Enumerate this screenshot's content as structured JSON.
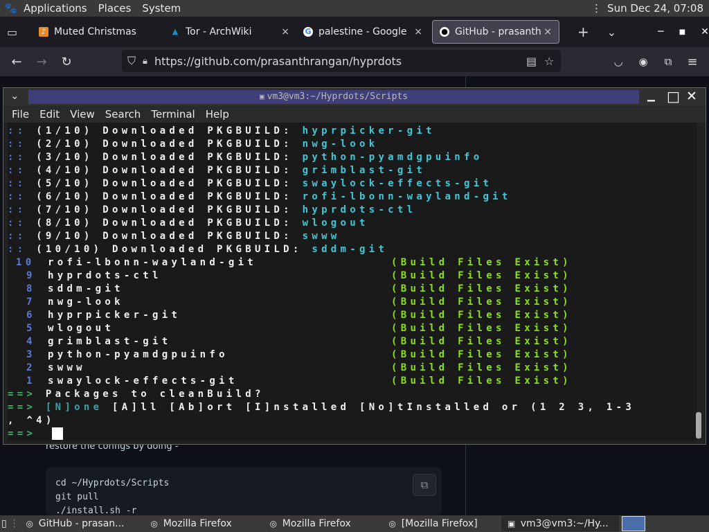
{
  "top_panel": {
    "menus": [
      "Applications",
      "Places",
      "System"
    ],
    "clock": "Sun Dec 24, 07:08"
  },
  "firefox": {
    "tabs": [
      {
        "title": "Muted Christmas",
        "close": "×"
      },
      {
        "title": "Tor - ArchWiki",
        "close": "×"
      },
      {
        "title": "palestine - Google",
        "close": "×"
      },
      {
        "title": "GitHub - prasanth",
        "close": "×"
      }
    ],
    "new_tab": "+",
    "tab_list": "⌄",
    "url": "https://github.com/prasanthrangan/hyprdots",
    "page": {
      "restore_text": "restore the configs by doing -",
      "code": "cd ~/Hyprdots/Scripts\ngit pull\n./install.sh -r"
    }
  },
  "terminal": {
    "title": "vm3@vm3:~/Hyprdots/Scripts",
    "menu": [
      "File",
      "Edit",
      "View",
      "Search",
      "Terminal",
      "Help"
    ],
    "downloads": [
      {
        "prefix": ":: ",
        "count": "(1/10)",
        "text": "Downloaded PKGBUILD:",
        "pkg": "hyprpicker-git"
      },
      {
        "prefix": ":: ",
        "count": "(2/10)",
        "text": "Downloaded PKGBUILD:",
        "pkg": "nwg-look"
      },
      {
        "prefix": ":: ",
        "count": "(3/10)",
        "text": "Downloaded PKGBUILD:",
        "pkg": "python-pyamdgpuinfo"
      },
      {
        "prefix": ":: ",
        "count": "(4/10)",
        "text": "Downloaded PKGBUILD:",
        "pkg": "grimblast-git"
      },
      {
        "prefix": ":: ",
        "count": "(5/10)",
        "text": "Downloaded PKGBUILD:",
        "pkg": "swaylock-effects-git"
      },
      {
        "prefix": ":: ",
        "count": "(6/10)",
        "text": "Downloaded PKGBUILD:",
        "pkg": "rofi-lbonn-wayland-git"
      },
      {
        "prefix": ":: ",
        "count": "(7/10)",
        "text": "Downloaded PKGBUILD:",
        "pkg": "hyprdots-ctl"
      },
      {
        "prefix": ":: ",
        "count": "(8/10)",
        "text": "Downloaded PKGBUILD:",
        "pkg": "wlogout"
      },
      {
        "prefix": ":: ",
        "count": "(9/10)",
        "text": "Downloaded PKGBUILD:",
        "pkg": "swww"
      },
      {
        "prefix": ":: ",
        "count": "(10/10)",
        "text": "Downloaded PKGBUILD:",
        "pkg": "sddm-git"
      }
    ],
    "packages": [
      {
        "num": "10",
        "name": "rofi-lbonn-wayland-git",
        "status": "(Build Files Exist)"
      },
      {
        "num": "9",
        "name": "hyprdots-ctl",
        "status": "(Build Files Exist)"
      },
      {
        "num": "8",
        "name": "sddm-git",
        "status": "(Build Files Exist)"
      },
      {
        "num": "7",
        "name": "nwg-look",
        "status": "(Build Files Exist)"
      },
      {
        "num": "6",
        "name": "hyprpicker-git",
        "status": "(Build Files Exist)"
      },
      {
        "num": "5",
        "name": "wlogout",
        "status": "(Build Files Exist)"
      },
      {
        "num": "4",
        "name": "grimblast-git",
        "status": "(Build Files Exist)"
      },
      {
        "num": "3",
        "name": "python-pyamdgpuinfo",
        "status": "(Build Files Exist)"
      },
      {
        "num": "2",
        "name": "swww",
        "status": "(Build Files Exist)"
      },
      {
        "num": "1",
        "name": "swaylock-effects-git",
        "status": "(Build Files Exist)"
      }
    ],
    "arrow": "==>",
    "question": "Packages to cleanBuild?",
    "options_highlight": "[N]one",
    "options_rest": " [A]ll [Ab]ort [I]nstalled [No]tInstalled or (1 2 3, 1-3",
    "options_wrap": ", ^4)"
  },
  "taskbar": {
    "items": [
      "GitHub - prasan...",
      "Mozilla Firefox",
      "Mozilla Firefox",
      "[Mozilla Firefox]",
      "vm3@vm3:~/Hy..."
    ]
  }
}
